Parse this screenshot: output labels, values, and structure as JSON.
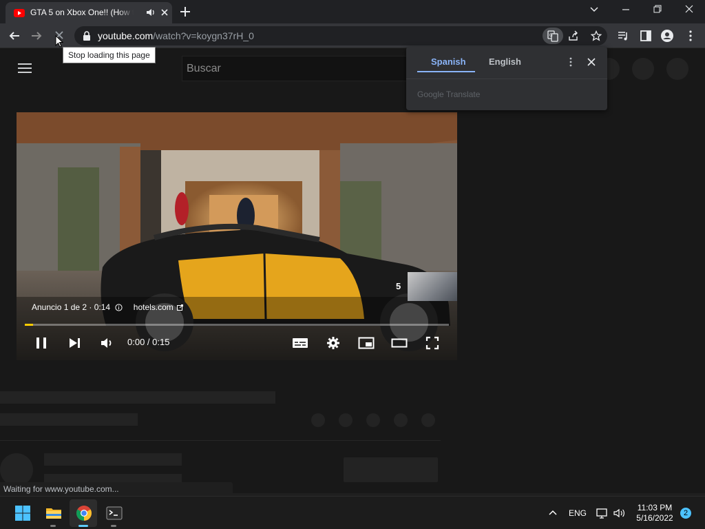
{
  "browser": {
    "tab": {
      "title": "GTA 5 on Xbox One!! (How to"
    },
    "address": {
      "host": "youtube.com",
      "path": "/watch?v=koygn37rH_0"
    },
    "tooltip": "Stop loading this page",
    "status_text": "Waiting for www.youtube.com..."
  },
  "youtube": {
    "search_placeholder": "Buscar",
    "player": {
      "ad_label": "Anuncio 1 de 2 · 0:14",
      "advertiser": "hotels.com",
      "skip_countdown": "5",
      "time": "0:00 / 0:15",
      "progress": 0.02
    }
  },
  "translate": {
    "tabs": [
      {
        "label": "Spanish",
        "active": true
      },
      {
        "label": "English",
        "active": false
      }
    ],
    "footer": "Google Translate"
  },
  "taskbar": {
    "language": "ENG",
    "time": "11:03 PM",
    "date": "5/16/2022",
    "notification_count": "2"
  },
  "colors": {
    "accent_blue": "#8ab4f8",
    "ad_progress": "#ffcc00",
    "youtube_red": "#ff0000"
  }
}
